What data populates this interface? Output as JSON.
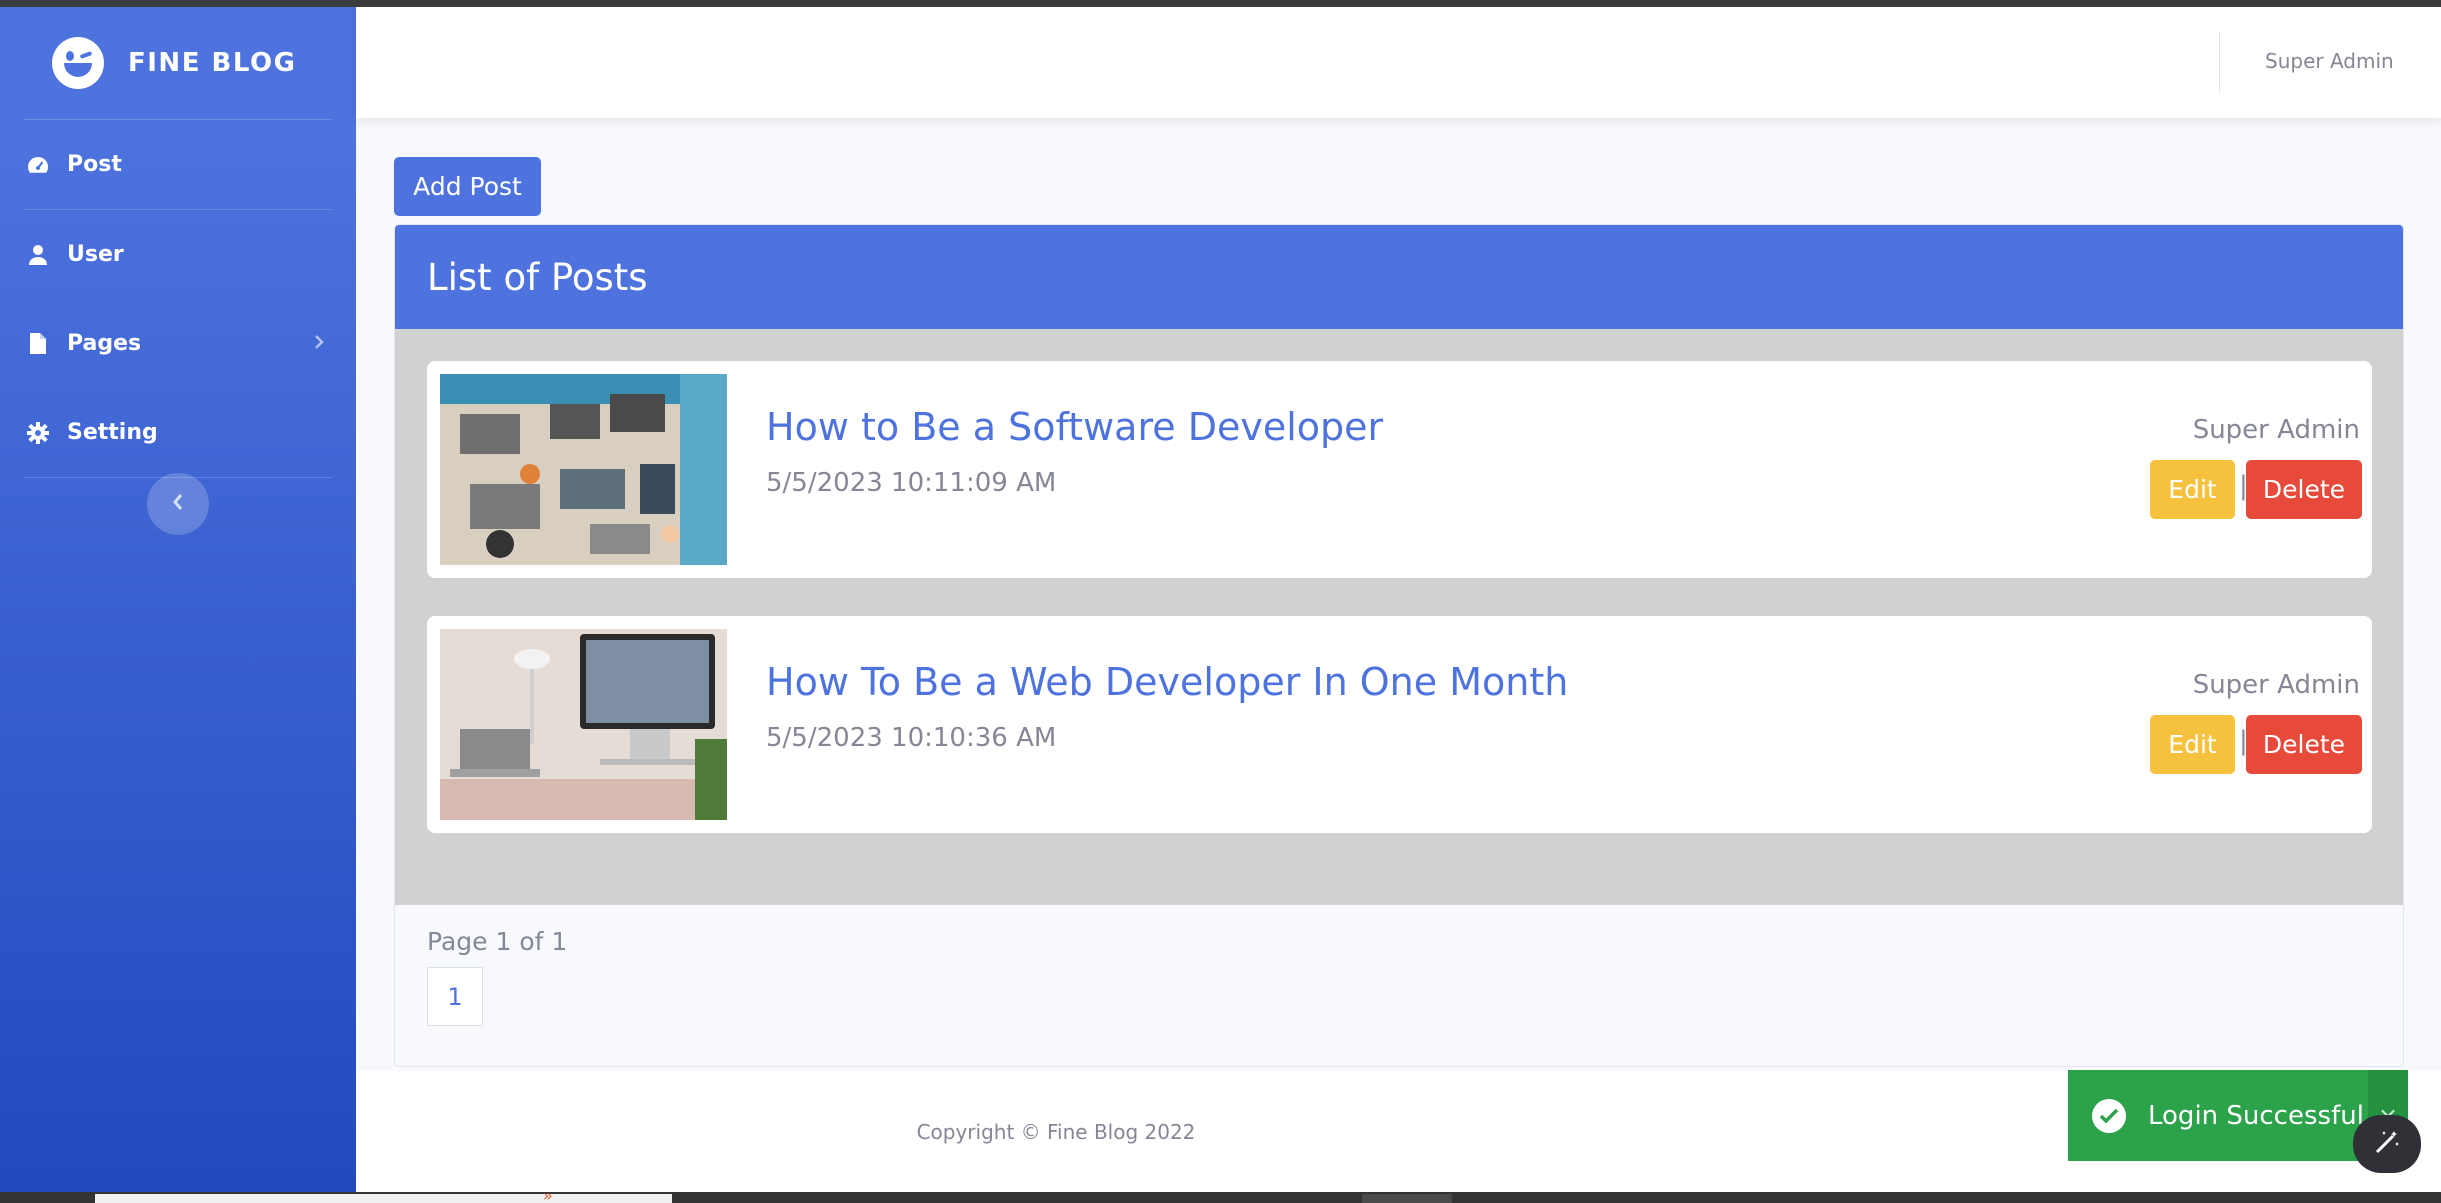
{
  "brand": {
    "name": "FINE BLOG"
  },
  "sidebar": {
    "items": [
      {
        "label": "Post",
        "icon": "gauge-icon"
      },
      {
        "label": "User",
        "icon": "user-icon"
      },
      {
        "label": "Pages",
        "icon": "file-icon"
      },
      {
        "label": "Setting",
        "icon": "gear-icon"
      }
    ]
  },
  "header": {
    "user_name": "Super Admin"
  },
  "main": {
    "add_button": "Add Post",
    "card_title": "List of Posts",
    "posts": [
      {
        "title": "How to Be a Software Developer",
        "date": "5/5/2023 10:11:09 AM",
        "author": "Super Admin",
        "edit_label": "Edit",
        "separator": "|",
        "delete_label": "Delete"
      },
      {
        "title": "How To Be a Web Developer In One Month",
        "date": "5/5/2023 10:10:36 AM",
        "author": "Super Admin",
        "edit_label": "Edit",
        "separator": "|",
        "delete_label": "Delete"
      }
    ],
    "pager": {
      "text": "Page 1 of 1",
      "current": "1"
    }
  },
  "footer": {
    "copyright": "Copyright © Fine Blog 2022"
  },
  "toast": {
    "message": "Login Successful",
    "close": "×"
  },
  "colors": {
    "primary": "#4e73df",
    "warning": "#f6c23e",
    "danger": "#e74a3b",
    "success": "#2ca34a"
  }
}
